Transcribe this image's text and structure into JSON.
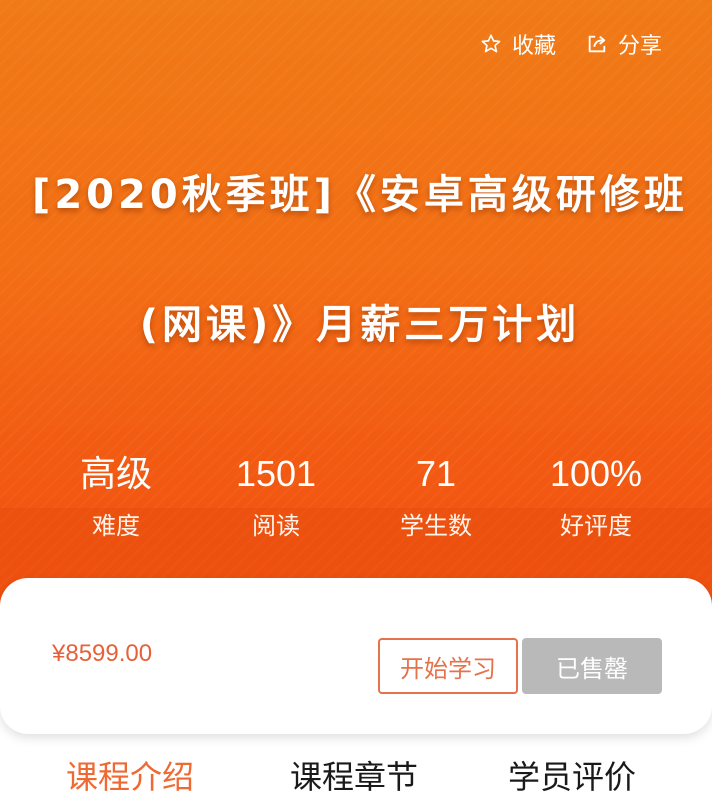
{
  "header": {
    "favorite_label": "收藏",
    "share_label": "分享"
  },
  "course": {
    "title": "[2020秋季班]《安卓高级研修班(网课)》月薪三万计划"
  },
  "stats": [
    {
      "value": "高级",
      "label": "难度"
    },
    {
      "value": "1501",
      "label": "阅读"
    },
    {
      "value": "71",
      "label": "学生数"
    },
    {
      "value": "100%",
      "label": "好评度"
    }
  ],
  "purchase": {
    "price": "¥8599.00",
    "start_label": "开始学习",
    "sold_out_label": "已售罄"
  },
  "tabs": [
    {
      "label": "课程介绍",
      "active": true
    },
    {
      "label": "课程章节",
      "active": false
    },
    {
      "label": "学员评价",
      "active": false
    }
  ],
  "colors": {
    "hero_top": "#f07a16",
    "hero_bottom": "#f0500f",
    "accent": "#ef6a32",
    "price": "#e8603a",
    "sold_out_bg": "#b9b9b9"
  },
  "icons": {
    "favorite": "star-outline-icon",
    "share": "share-icon"
  }
}
